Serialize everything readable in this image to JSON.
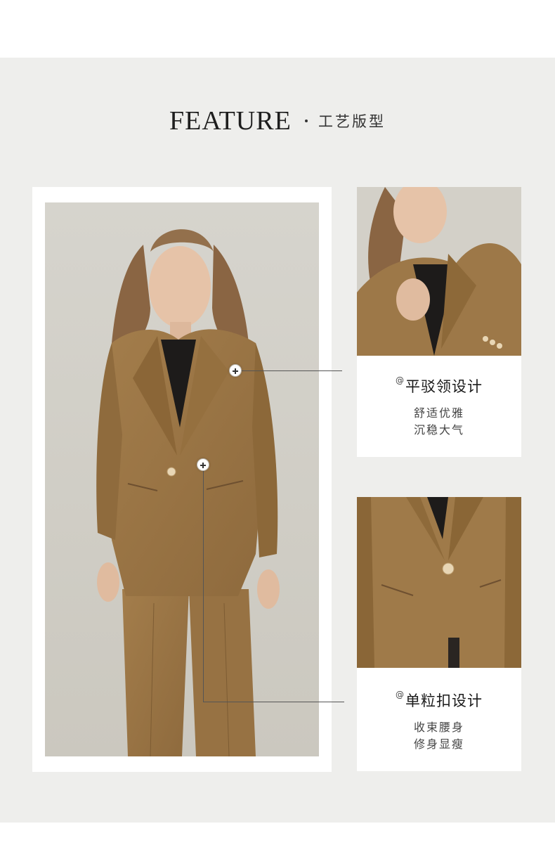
{
  "header": {
    "title_en": "FEATURE",
    "title_cn": "工艺版型"
  },
  "features": [
    {
      "heading": "平驳领设计",
      "lines": [
        "舒适优雅",
        "沉稳大气"
      ]
    },
    {
      "heading": "单粒扣设计",
      "lines": [
        "收束腰身",
        "修身显瘦"
      ]
    }
  ],
  "marker_symbol": "@",
  "colors": {
    "background": "#eeeeec",
    "card": "#ffffff",
    "suit": "#9d7848",
    "accent_line": "#555555"
  }
}
